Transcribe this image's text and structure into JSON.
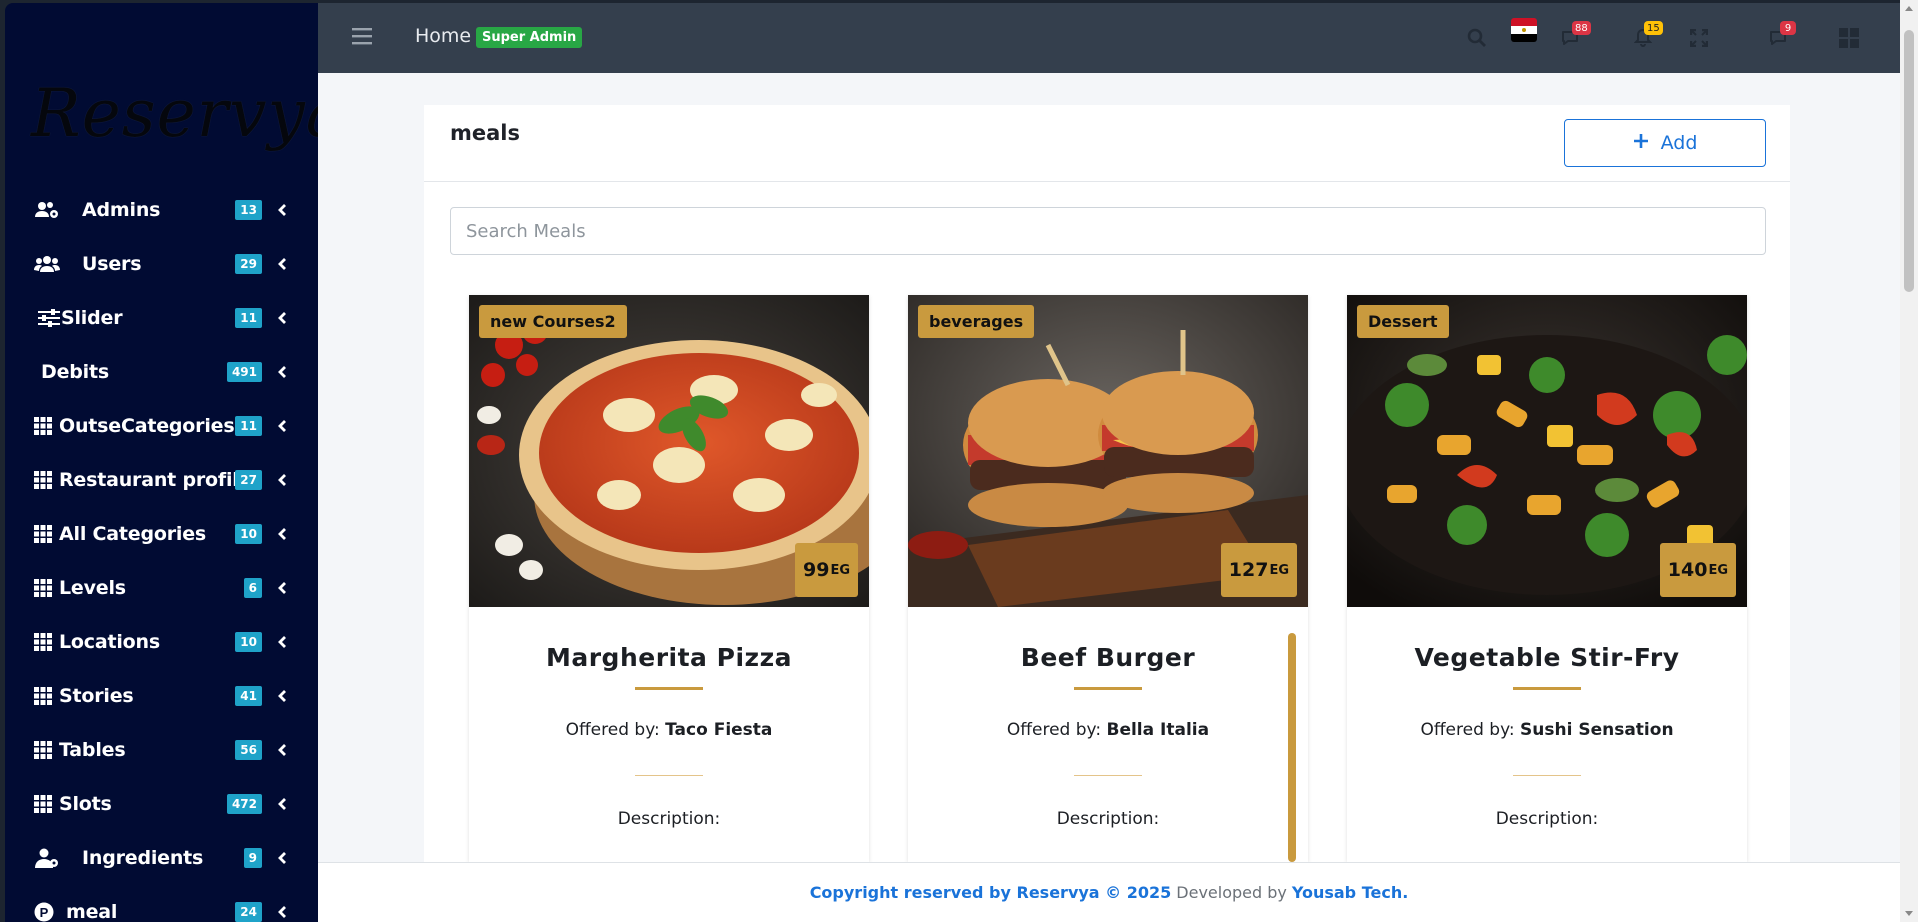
{
  "brand": {
    "logo_text": "Reservya"
  },
  "sidebar": {
    "items": [
      {
        "label": "Admins",
        "badge": "13",
        "icon": "users-cog-icon"
      },
      {
        "label": "Users",
        "badge": "29",
        "icon": "users-icon"
      },
      {
        "label": "Slider",
        "badge": "11",
        "icon": "sliders-icon"
      },
      {
        "label": "Debits",
        "badge": "491",
        "icon": ""
      },
      {
        "label": "OutseCategories",
        "badge": "11",
        "icon": "grid-icon"
      },
      {
        "label": "Restaurant profiles",
        "badge": "27",
        "icon": "grid-icon"
      },
      {
        "label": "All Categories",
        "badge": "10",
        "icon": "grid-icon"
      },
      {
        "label": "Levels",
        "badge": "6",
        "icon": "grid-icon"
      },
      {
        "label": "Locations",
        "badge": "10",
        "icon": "grid-icon"
      },
      {
        "label": "Stories",
        "badge": "41",
        "icon": "grid-icon"
      },
      {
        "label": "Tables",
        "badge": "56",
        "icon": "grid-icon"
      },
      {
        "label": "Slots",
        "badge": "472",
        "icon": "grid-icon"
      },
      {
        "label": "Ingredients",
        "badge": "9",
        "icon": "user-tie-icon"
      },
      {
        "label": "meal",
        "badge": "24",
        "icon": "p-circle-icon"
      }
    ]
  },
  "topbar": {
    "home_label": "Home",
    "role_badge": "Super Admin",
    "messages_count": "88",
    "notifications_count": "15",
    "chat_count": "9"
  },
  "page": {
    "title": "meals",
    "add_label": "Add",
    "search_placeholder": "Search Meals"
  },
  "meals": [
    {
      "name": "Margherita Pizza",
      "category": "new Courses2",
      "price": "99",
      "currency": "EG",
      "offered_prefix": "Offered by:",
      "restaurant": "Taco Fiesta",
      "description_label": "Description:"
    },
    {
      "name": "Beef Burger",
      "category": "beverages",
      "price": "127",
      "currency": "EG",
      "offered_prefix": "Offered by:",
      "restaurant": "Bella Italia",
      "description_label": "Description:"
    },
    {
      "name": "Vegetable Stir-Fry",
      "category": "Dessert",
      "price": "140",
      "currency": "EG",
      "offered_prefix": "Offered by:",
      "restaurant": "Sushi Sensation",
      "description_label": "Description:"
    }
  ],
  "footer": {
    "copyright": "Copyright reserved by Reservya © 2025",
    "developed_by": "Developed by",
    "developer": "Yousab Tech."
  },
  "colors": {
    "sidebar_bg": "#010b33",
    "topbar_bg": "#343f4d",
    "accent_gold": "#c99a3e",
    "badge_cyan": "#1fa3c9",
    "link_blue": "#1a73d9",
    "success_green": "#28a745"
  }
}
